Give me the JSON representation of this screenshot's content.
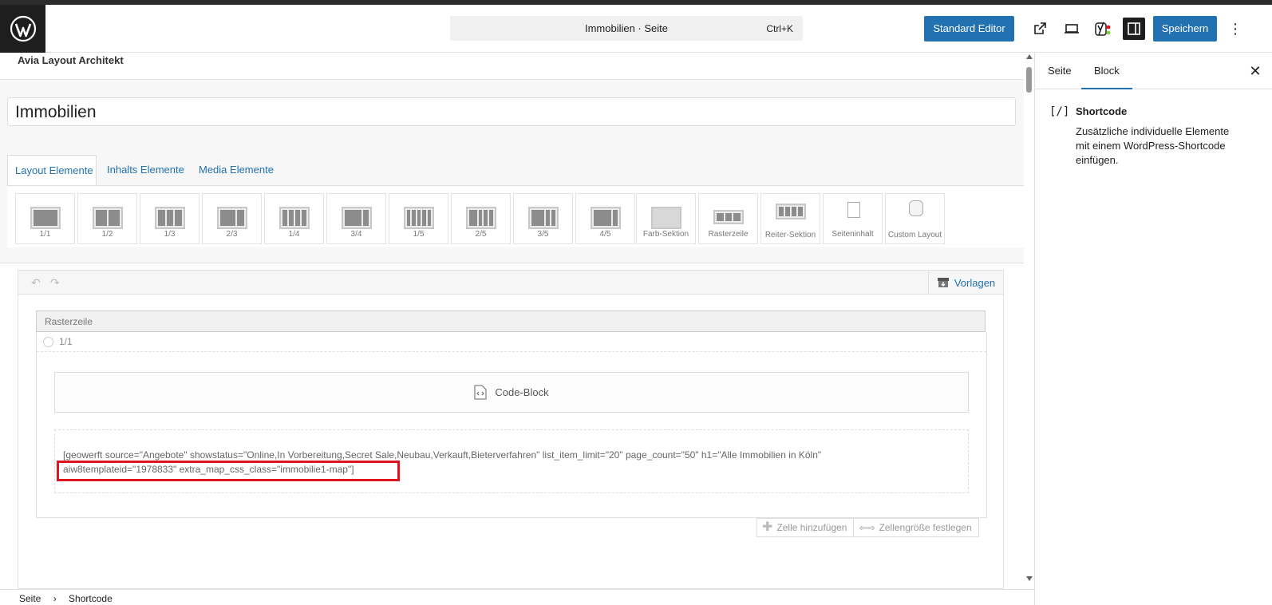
{
  "header": {
    "command_title": "Immobilien · Seite",
    "command_shortcut": "Ctrl+K",
    "standard_editor_label": "Standard Editor",
    "save_label": "Speichern"
  },
  "avia": {
    "title": "Avia Layout Architekt",
    "page_title": "Immobilien",
    "tabs": [
      "Layout Elemente",
      "Inhalts Elemente",
      "Media Elemente"
    ],
    "tiles": [
      "1/1",
      "1/2",
      "1/3",
      "2/3",
      "1/4",
      "3/4",
      "1/5",
      "2/5",
      "3/5",
      "4/5",
      "Farb-Sektion",
      "Rasterzeile",
      "Reiter-Sektion",
      "Seiteninhalt",
      "Custom Layout"
    ]
  },
  "builder": {
    "vorlagen_label": "Vorlagen",
    "grid_label": "Rasterzeile",
    "cell_label": "1/1",
    "codeblock_label": "Code-Block",
    "shortcode_line1": "[geowerft source=\"Angebote\" showstatus=\"Online,In Vorbereitung,Secret Sale,Neubau,Verkauft,Bieterverfahren\" list_item_limit=\"20\" page_count=\"50\" h1=\"Alle Immobilien in Köln\"",
    "shortcode_line2": "aiw8templateid=\"1978833\" extra_map_css_class=\"immobilie1-map\"]",
    "add_cell_label": "Zelle hinzufügen",
    "cell_size_label": "Zellengröße festlegen"
  },
  "footer": {
    "breadcrumb": [
      "Seite",
      "Shortcode"
    ]
  },
  "sidebar": {
    "tabs": [
      "Seite",
      "Block"
    ],
    "active_tab": "Block",
    "block_icon": "[/]",
    "block_title": "Shortcode",
    "block_description": "Zusätzliche individuelle Elemente mit einem WordPress-Shortcode einfügen."
  },
  "colors": {
    "accent": "#2271b1",
    "highlight": "#e0141e"
  }
}
